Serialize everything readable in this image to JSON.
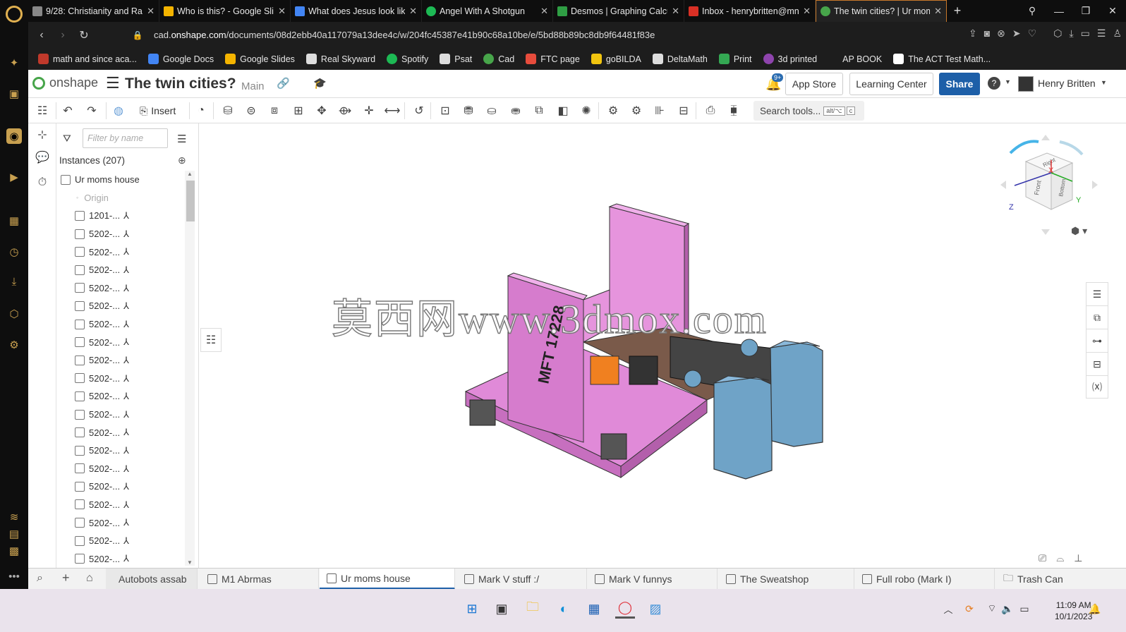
{
  "browser": {
    "tabs": [
      {
        "title": "9/28: Christianity and Rac",
        "color": "#888888"
      },
      {
        "title": "Who is this? - Google Slid",
        "color": "#f4b400"
      },
      {
        "title": "What does Jesus look like",
        "color": "#4285f4"
      },
      {
        "title": "Angel With A Shotgun",
        "color": "#1db954"
      },
      {
        "title": "Desmos | Graphing Calcul",
        "color": "#2f9e44"
      },
      {
        "title": "Inbox - henrybritten@mn",
        "color": "#d93025"
      },
      {
        "title": "The twin cities? | Ur moms",
        "color": "#47a54a"
      }
    ],
    "url_prefix": "cad.",
    "url_domain": "onshape.com",
    "url_path": "/documents/08d2ebb40a117079a13dee4c/w/204fc45387e41b90c68a10be/e/5bd88b89bc8db9f64481f83e",
    "bookmarks": [
      {
        "label": "math and since aca...",
        "color": "#c0392b"
      },
      {
        "label": "Google Docs",
        "color": "#4285f4"
      },
      {
        "label": "Google Slides",
        "color": "#f4b400"
      },
      {
        "label": "Real Skyward",
        "color": "#dddddd"
      },
      {
        "label": "Spotify",
        "color": "#1db954"
      },
      {
        "label": "Psat",
        "color": "#dddddd"
      },
      {
        "label": "Cad",
        "color": "#47a54a"
      },
      {
        "label": "FTC page",
        "color": "#e74c3c"
      },
      {
        "label": "goBILDA",
        "color": "#f1c40f"
      },
      {
        "label": "DeltaMath",
        "color": "#dddddd"
      },
      {
        "label": "Print",
        "color": "#34a853"
      },
      {
        "label": "3d printed",
        "color": "#8e44ad"
      },
      {
        "label": "AP BOOK",
        "color": ""
      },
      {
        "label": "The ACT Test Math...",
        "color": "#ffffff"
      }
    ]
  },
  "header": {
    "brand": "onshape",
    "doc_title": "The twin cities?",
    "branch": "Main",
    "notif_count": "9+",
    "app_store": "App Store",
    "learning_center": "Learning Center",
    "share": "Share",
    "user": "Henry Britten"
  },
  "toolbar": {
    "insert": "Insert",
    "search_label": "Search tools...",
    "search_key1": "alt/⌥",
    "search_key2": "c"
  },
  "panel": {
    "filter_placeholder": "Filter by name",
    "instances_label": "Instances (207)",
    "root": "Ur moms house",
    "origin": "Origin",
    "items": [
      "1201-...",
      "5202-...",
      "5202-...",
      "5202-...",
      "5202-...",
      "5202-...",
      "5202-...",
      "5202-...",
      "5202-...",
      "5202-...",
      "5202-...",
      "5202-...",
      "5202-...",
      "5202-...",
      "5202-...",
      "5202-...",
      "5202-...",
      "5202-...",
      "5202-...",
      "5202-..."
    ]
  },
  "viewport": {
    "watermark": "莫西网www.3dmox.com",
    "model_label": "MFT 17228",
    "cube": {
      "top": "Right",
      "front": "Front",
      "right": "Bottom",
      "x": "X",
      "y": "Y",
      "z": "Z"
    }
  },
  "doc_tabs": {
    "folder": "Autobots assab",
    "tabs": [
      "M1 Abrmas",
      "Ur moms house",
      "Mark V stuff :/",
      "Mark V funnys",
      "The Sweatshop",
      "Full robo (Mark I)"
    ],
    "active": "Ur moms house",
    "trash": "Trash Can"
  },
  "taskbar": {
    "time": "11:09 AM",
    "date": "10/1/2023"
  },
  "colors": {
    "accent": "#1d5fa8",
    "onshape_green": "#47a54a",
    "model_pink": "#e28ad9",
    "model_blue": "#6fa3c7"
  }
}
